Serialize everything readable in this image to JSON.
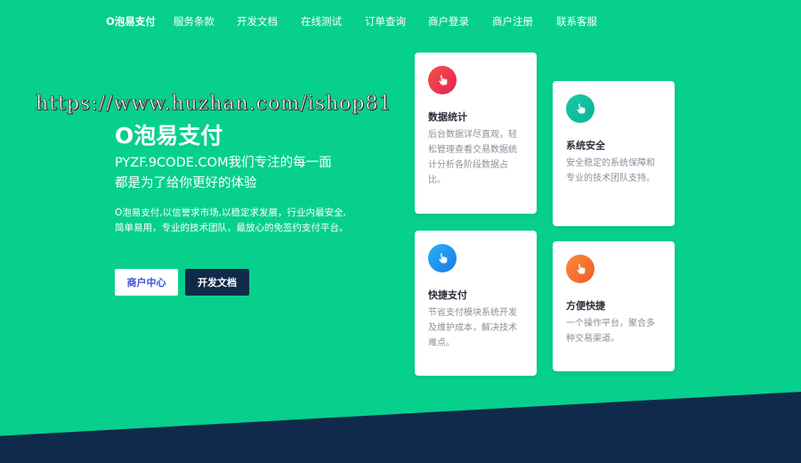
{
  "nav": {
    "brand": "O泡易支付",
    "items": [
      "服务条款",
      "开发文档",
      "在线测试",
      "订单查询",
      "商户登录",
      "商户注册",
      "联系客服"
    ]
  },
  "watermark": "https://www.huzhan.com/ishop81",
  "hero": {
    "title": "O泡易支付",
    "subtitle_lines": [
      "PYZF.9CODE.COM我们专注的每一面",
      "都是为了给你更好的体验"
    ],
    "description_lines": [
      "O泡易支付,以信誉求市场,以稳定求发展，行业内最安全,",
      "简单易用，专业的技术团队，最放心的免签约支付平台。"
    ],
    "buttons": {
      "merchant_center": "商户中心",
      "dev_docs": "开发文档"
    }
  },
  "cards": [
    {
      "title": "数据统计",
      "desc": "后台数据详尽直观，轻松管理查看交易数据统计分析各阶段数据占比。",
      "icon": "hand-pointer-icon",
      "color": "#e8364e"
    },
    {
      "title": "系统安全",
      "desc": "安全稳定的系统保障和专业的技术团队支持。",
      "icon": "hand-pointer-icon",
      "color": "#12c2a0"
    },
    {
      "title": "快捷支付",
      "desc": "节省支付模块系统开发及维护成本，解决技术难点。",
      "icon": "hand-pointer-icon",
      "color": "#2196ee"
    },
    {
      "title": "方便快捷",
      "desc": "一个操作平台，聚合多种交易渠道。",
      "icon": "hand-pointer-icon",
      "color": "#f46c32"
    }
  ],
  "colors": {
    "background": "#06d08c",
    "navy": "#0f2a4a",
    "button_text": "#3a52d6"
  }
}
